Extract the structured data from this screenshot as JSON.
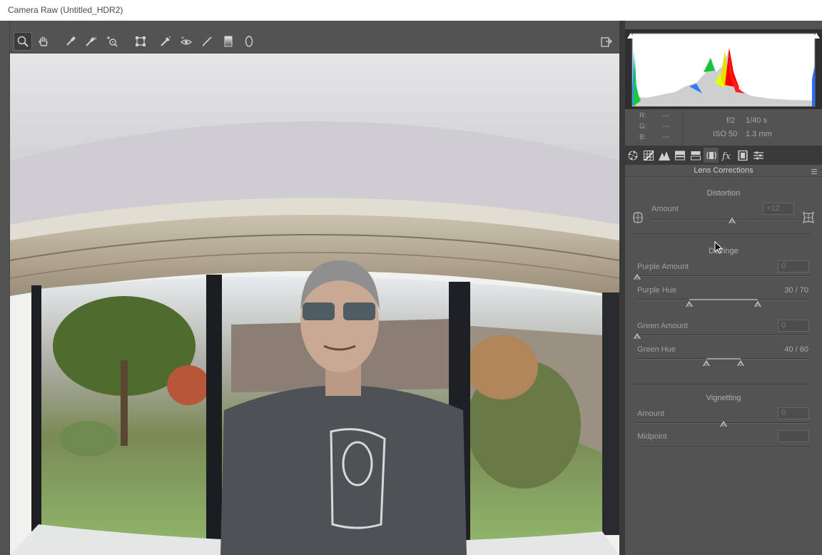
{
  "window": {
    "title": "Camera Raw (Untitled_HDR2)"
  },
  "toolbar": {
    "tools": [
      {
        "name": "zoom-tool",
        "icon": "magnifier-icon",
        "active": true
      },
      {
        "name": "hand-tool",
        "icon": "hand-icon"
      },
      {
        "name": "white-balance-tool",
        "icon": "eyedropper-icon"
      },
      {
        "name": "color-sampler-tool",
        "icon": "color-sampler-icon"
      },
      {
        "name": "targeted-adjustment-tool",
        "icon": "target-adjust-icon"
      },
      {
        "name": "transform-tool",
        "icon": "transform-icon"
      },
      {
        "name": "spot-removal-tool",
        "icon": "spot-removal-icon"
      },
      {
        "name": "red-eye-tool",
        "icon": "red-eye-icon"
      },
      {
        "name": "adjustment-brush-tool",
        "icon": "brush-icon"
      },
      {
        "name": "graduated-filter-tool",
        "icon": "gradient-icon"
      },
      {
        "name": "radial-filter-tool",
        "icon": "radial-icon"
      }
    ],
    "right_icon": "export-icon"
  },
  "histogram": {
    "rgb": {
      "r_label": "R:",
      "g_label": "G:",
      "b_label": "B:",
      "r": "---",
      "g": "---",
      "b": "---"
    },
    "camera": {
      "aperture": "f/2",
      "shutter": "1/40 s",
      "iso": "ISO 50",
      "focal": "1.3 mm"
    }
  },
  "panel_tabs": [
    {
      "icon": "basic-aperture-icon"
    },
    {
      "icon": "tone-curve-grid-icon"
    },
    {
      "icon": "detail-mountains-icon"
    },
    {
      "icon": "hsl-icon"
    },
    {
      "icon": "split-toning-icon"
    },
    {
      "icon": "lens-corrections-icon",
      "active": true
    },
    {
      "icon": "fx-icon"
    },
    {
      "icon": "camera-calibration-film-icon"
    },
    {
      "icon": "presets-sliders-icon"
    }
  ],
  "panel": {
    "title": "Lens Corrections",
    "distortion": {
      "heading": "Distortion",
      "amount_label": "Amount",
      "amount_value": "+12",
      "amount_position": 0.56
    },
    "defringe": {
      "heading": "Defringe",
      "purple_amount_label": "Purple Amount",
      "purple_amount_value": "0",
      "purple_amount_position": 0.0,
      "purple_hue_label": "Purple Hue",
      "purple_hue_value": "30 / 70",
      "purple_hue_low": 0.3,
      "purple_hue_high": 0.7,
      "green_amount_label": "Green Amount",
      "green_amount_value": "0",
      "green_amount_position": 0.0,
      "green_hue_label": "Green Hue",
      "green_hue_value": "40 / 60",
      "green_hue_low": 0.4,
      "green_hue_high": 0.6
    },
    "vignetting": {
      "heading": "Vignetting",
      "amount_label": "Amount",
      "amount_value": "0",
      "amount_position": 0.5,
      "midpoint_label": "Midpoint",
      "midpoint_value": ""
    }
  }
}
